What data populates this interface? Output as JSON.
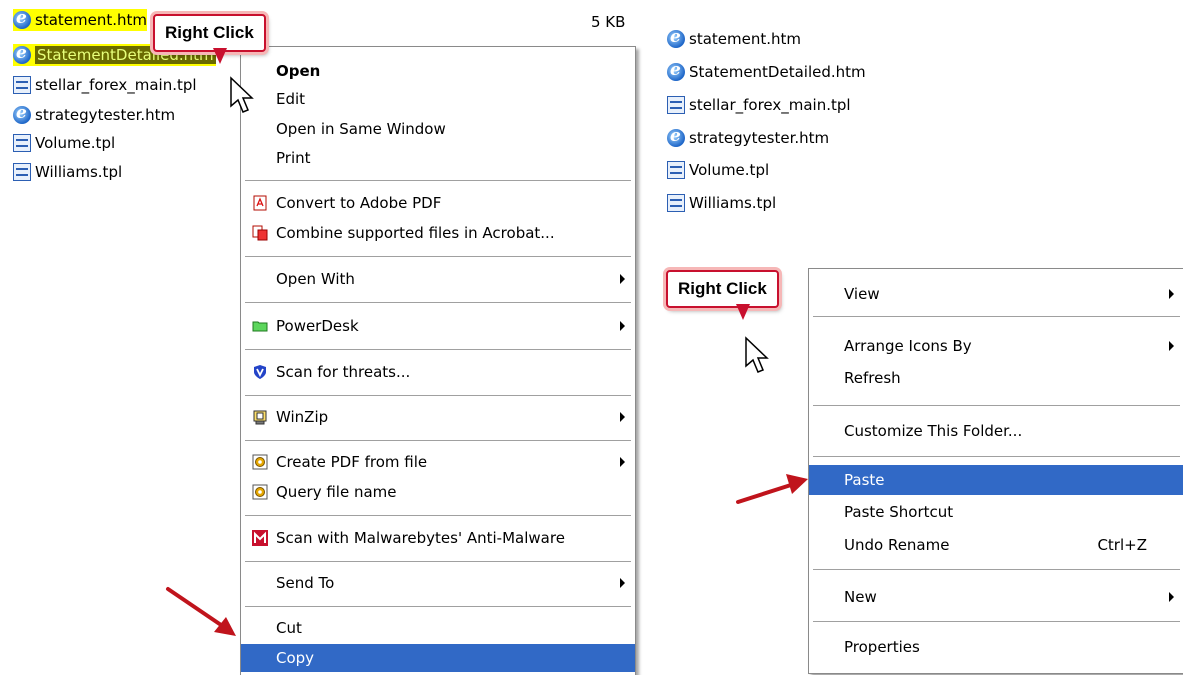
{
  "left_pane": {
    "files": [
      {
        "name": "statement.htm",
        "type": "ie"
      },
      {
        "name": "StatementDetailed.htm",
        "type": "ie"
      },
      {
        "name": "stellar_forex_main.tpl",
        "type": "tpl"
      },
      {
        "name": "strategytester.htm",
        "type": "ie"
      },
      {
        "name": "Volume.tpl",
        "type": "tpl"
      },
      {
        "name": "Williams.tpl",
        "type": "tpl"
      }
    ],
    "size_column": "5 KB",
    "callout": "Right Click",
    "context_menu": {
      "items": [
        {
          "label": "Open",
          "bold": true
        },
        {
          "label": "Edit"
        },
        {
          "label": "Open in Same Window"
        },
        {
          "label": "Print"
        },
        {
          "label": "Convert to Adobe PDF",
          "icon": "adobe-pdf-icon"
        },
        {
          "label": "Combine supported files in Acrobat...",
          "icon": "acrobat-combine-icon"
        },
        {
          "label": "Open With",
          "submenu": true
        },
        {
          "label": "PowerDesk",
          "icon": "powerdesk-folder-icon",
          "submenu": true
        },
        {
          "label": "Scan for threats...",
          "icon": "shield-icon"
        },
        {
          "label": "WinZip",
          "icon": "winzip-icon",
          "submenu": true
        },
        {
          "label": "Create PDF from file",
          "icon": "pdf-gear-icon",
          "submenu": true
        },
        {
          "label": "Query file name",
          "icon": "pdf-gear-icon"
        },
        {
          "label": "Scan with Malwarebytes' Anti-Malware",
          "icon": "malwarebytes-icon"
        },
        {
          "label": "Send To",
          "submenu": true
        },
        {
          "label": "Cut"
        },
        {
          "label": "Copy",
          "highlighted": true
        }
      ]
    }
  },
  "right_pane": {
    "files": [
      {
        "name": "statement.htm",
        "type": "ie"
      },
      {
        "name": "StatementDetailed.htm",
        "type": "ie"
      },
      {
        "name": "stellar_forex_main.tpl",
        "type": "tpl"
      },
      {
        "name": "strategytester.htm",
        "type": "ie"
      },
      {
        "name": "Volume.tpl",
        "type": "tpl"
      },
      {
        "name": "Williams.tpl",
        "type": "tpl"
      }
    ],
    "callout": "Right Click",
    "context_menu": {
      "items": [
        {
          "label": "View",
          "submenu": true
        },
        {
          "label": "Arrange Icons By",
          "submenu": true
        },
        {
          "label": "Refresh"
        },
        {
          "label": "Customize This Folder..."
        },
        {
          "label": "Paste",
          "highlighted": true
        },
        {
          "label": "Paste Shortcut"
        },
        {
          "label": "Undo Rename",
          "shortcut": "Ctrl+Z"
        },
        {
          "label": "New",
          "submenu": true
        },
        {
          "label": "Properties"
        }
      ]
    }
  },
  "colors": {
    "menu_highlight": "#3169c6",
    "selection_highlight": "#ffff00",
    "callout_border": "#c8102e",
    "annotation_arrow": "#c0141c"
  }
}
